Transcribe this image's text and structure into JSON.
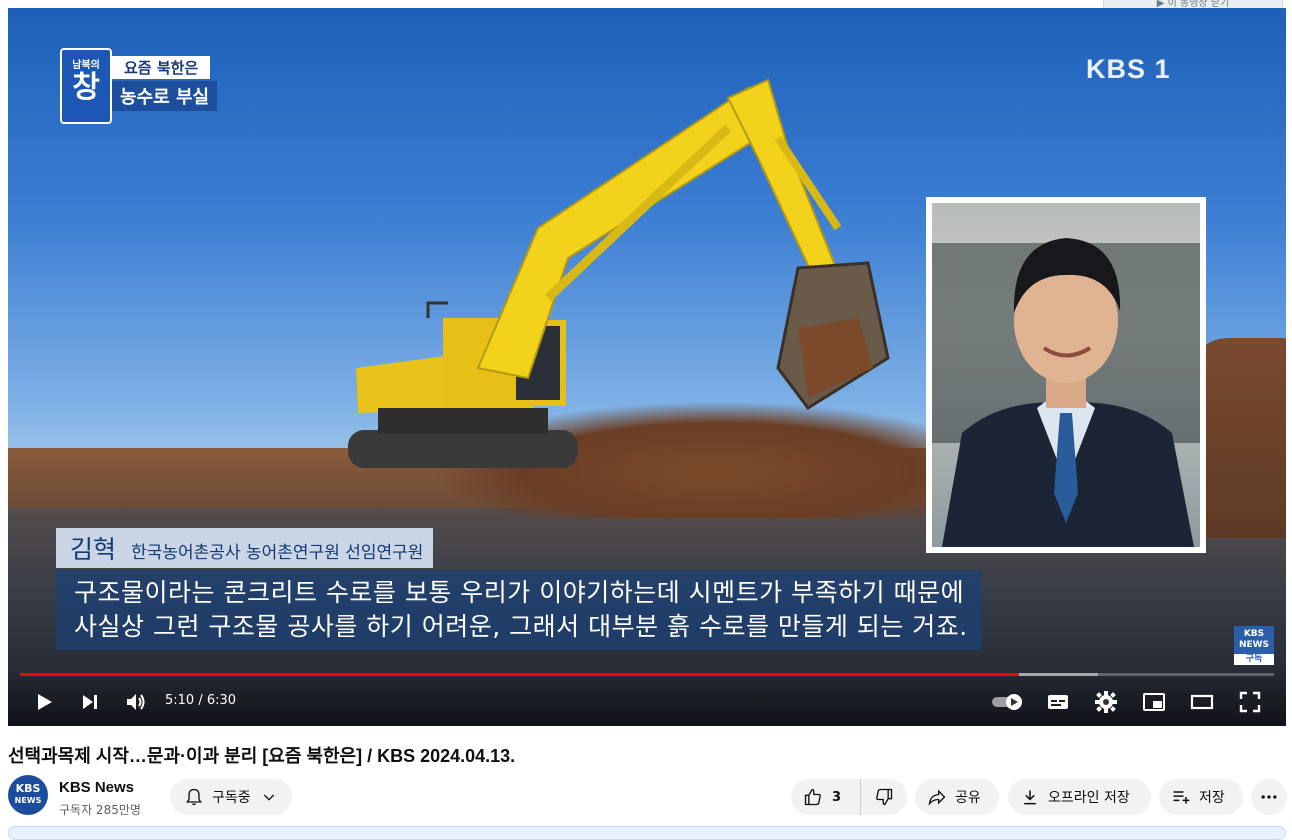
{
  "top_pill_text": "▶︎ 이 동영상 닫기",
  "video": {
    "program_badge_top": "남북의",
    "program_badge_main": "창",
    "program_tag_line1": "요즘 북한은",
    "program_tag_line2": "농수로 부실",
    "broadcaster_logo": "KBS 1",
    "interviewee_name": "김혁",
    "interviewee_title": "한국농어촌공사 농어촌연구원 선임연구원",
    "caption_line1": "구조물이라는 콘크리트 수로를 보통 우리가 이야기하는데 시멘트가 부족하기 때문에",
    "caption_line2": "사실상 그런 구조물 공사를 하기 어려운, 그래서 대부분 흙 수로를 만들게 되는 거죠.",
    "watermark_top": "KBS",
    "watermark_mid": "NEWS",
    "watermark_sub": "구독"
  },
  "player": {
    "time_display": "5:10 / 6:30",
    "progress_played_fraction": 0.797,
    "progress_buffered_fraction": 0.86,
    "autoplay": true,
    "icons": [
      "play-icon",
      "next-icon",
      "volume-icon",
      "autoplay-toggle-icon",
      "subtitles-icon",
      "settings-icon",
      "miniplayer-icon",
      "theater-icon",
      "fullscreen-icon"
    ]
  },
  "title": "선택과목제 시작…문과·이과 분리 [요즘 북한은] / KBS 2024.04.13.",
  "channel": {
    "avatar_line1": "KBS",
    "avatar_line2": "NEWS",
    "name": "KBS News",
    "subscribers": "구독자 285만명",
    "subscribe_label": "구독중"
  },
  "actions": {
    "like_count": "3",
    "share_label": "공유",
    "download_label": "오프라인 저장",
    "save_label": "저장"
  },
  "colors": {
    "progress_red": "#ff0000",
    "button_bg": "#f2f2f2",
    "caption_bg": "#1c4074"
  }
}
